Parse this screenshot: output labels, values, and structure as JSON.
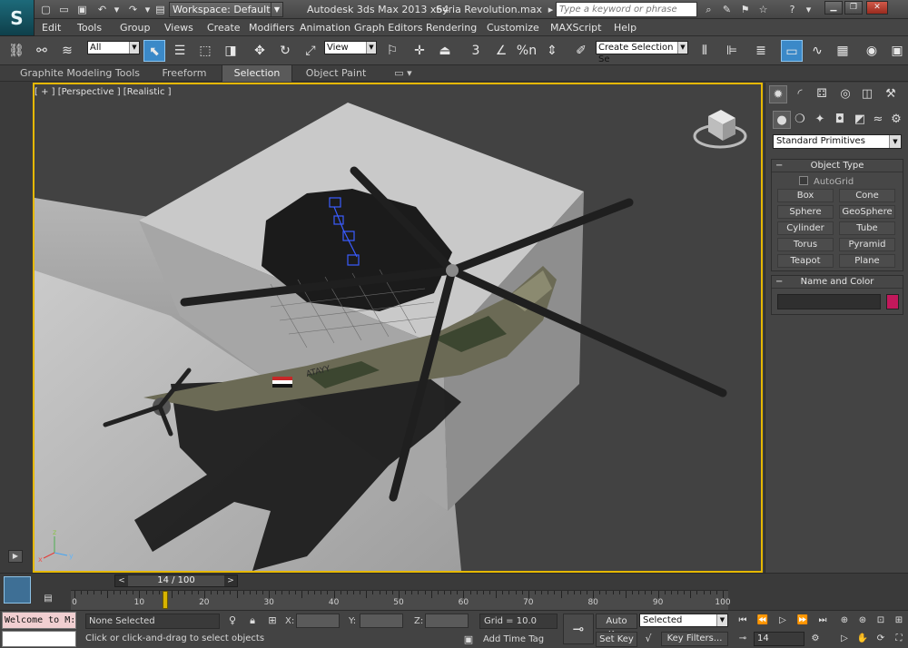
{
  "titlebar": {
    "app_logo": "S",
    "workspace_label": "Workspace: Default",
    "app_title": "Autodesk 3ds Max  2013 x64",
    "file_name": "Syria Revolution.max",
    "search_placeholder": "Type a keyword or phrase"
  },
  "menu": {
    "items": [
      "Edit",
      "Tools",
      "Group",
      "Views",
      "Create",
      "Modifiers",
      "Animation",
      "Graph Editors",
      "Rendering",
      "Customize",
      "MAXScript",
      "Help"
    ]
  },
  "toolbar": {
    "selection_filter": "All",
    "reference_coord": "View",
    "named_selection": "Create Selection Se",
    "angle_snap_label": "3",
    "percent_snap_label": "%n"
  },
  "ribbon": {
    "tabs": [
      "Graphite Modeling Tools",
      "Freeform",
      "Selection",
      "Object Paint"
    ],
    "active_tab": "Selection"
  },
  "viewport": {
    "label": "[ + ] [Perspective ] [Realistic ]",
    "flag_text": "ATAYY"
  },
  "command_panel": {
    "category": "Standard Primitives",
    "object_type_title": "Object Type",
    "autogrid_label": "AutoGrid",
    "object_buttons": [
      "Box",
      "Cone",
      "Sphere",
      "GeoSphere",
      "Cylinder",
      "Tube",
      "Torus",
      "Pyramid",
      "Teapot",
      "Plane"
    ],
    "name_color_title": "Name and Color",
    "object_color": "#c2185b"
  },
  "timeline": {
    "frame_display": "14 / 100",
    "ticks": [
      0,
      10,
      20,
      30,
      40,
      50,
      60,
      70,
      80,
      90,
      100
    ],
    "current_frame": 14,
    "total_frames": 100
  },
  "status": {
    "listener_text": "Welcome to M:",
    "selection_status": "None Selected",
    "prompt": "Click or click-and-drag to select objects",
    "x_label": "X:",
    "y_label": "Y:",
    "z_label": "Z:",
    "grid": "Grid = 10.0",
    "add_time_tag": "Add Time Tag",
    "auto_key": "Auto Key",
    "set_key": "Set Key",
    "key_mode": "Selected",
    "key_filters": "Key Filters...",
    "frame_field": "14"
  },
  "colors": {
    "active_viewport_border": "#e6b800",
    "accent_blue": "#3b89c8"
  }
}
